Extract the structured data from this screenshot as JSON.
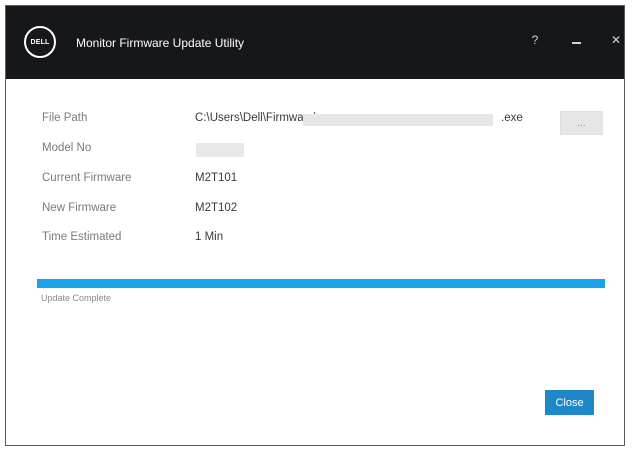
{
  "window": {
    "title": "Monitor Firmware Update Utility",
    "logo_text": "DELL",
    "help_label": "?",
    "close_label": "✕"
  },
  "fields": {
    "file_path": {
      "label": "File Path",
      "value": "C:\\Users\\Dell\\Firmware\\",
      "ext": ".exe"
    },
    "model_no": {
      "label": "Model No"
    },
    "current_firmware": {
      "label": "Current Firmware",
      "value": "M2T101"
    },
    "new_firmware": {
      "label": "New Firmware",
      "value": "M2T102"
    },
    "time_estimated": {
      "label": "Time Estimated",
      "value": "1 Min"
    }
  },
  "browse_label": "...",
  "progress": {
    "fraction": 1.0,
    "color": "#1aa3e8",
    "status": "Update Complete"
  },
  "close_button_label": "Close",
  "colors": {
    "titlebar": "#15171a",
    "accent": "#1d87c8"
  }
}
